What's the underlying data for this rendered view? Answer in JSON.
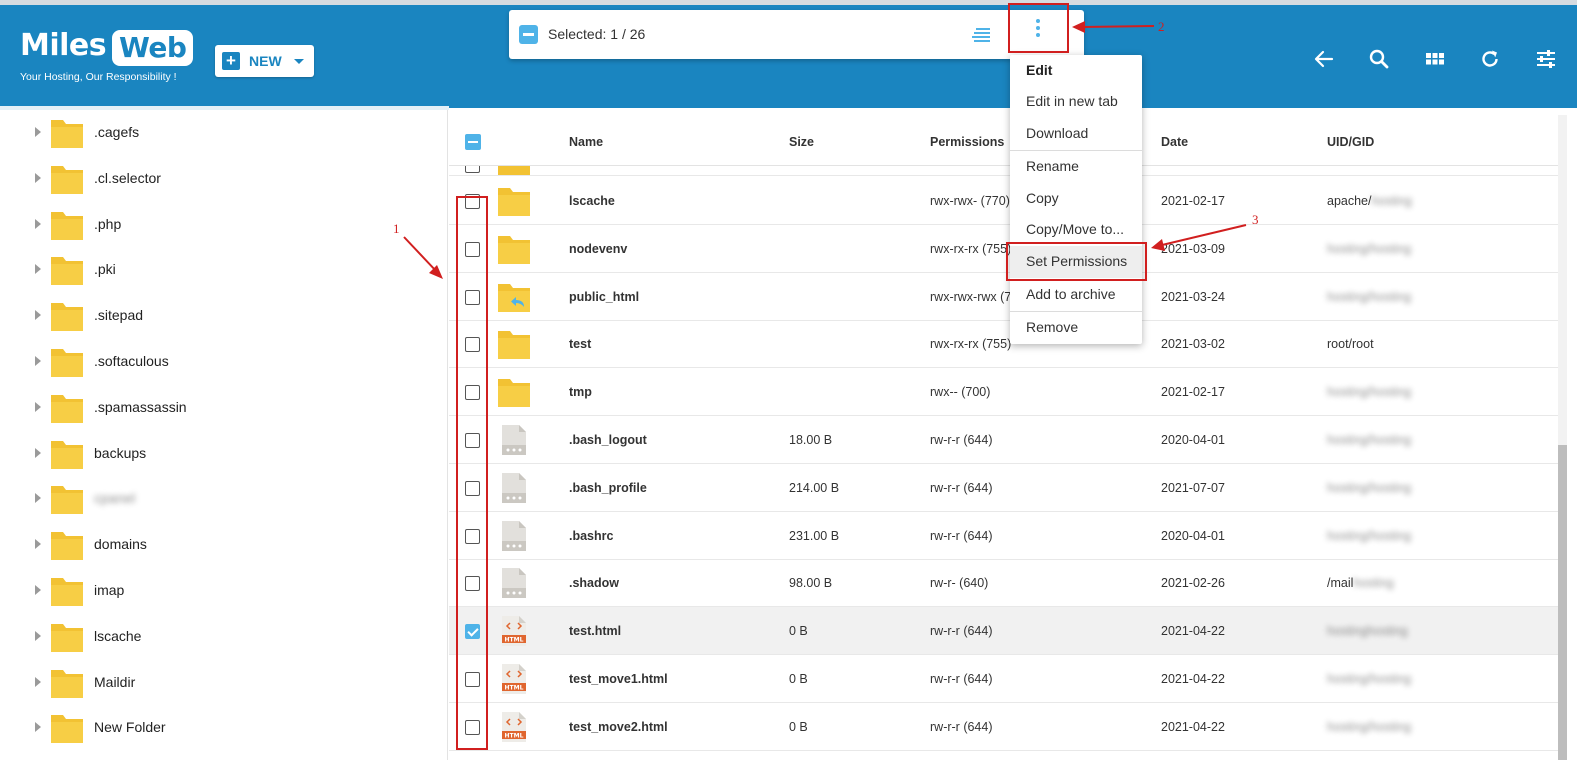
{
  "brand": {
    "logo_miles": "Miles",
    "logo_web": "Web",
    "tagline": "Your Hosting, Our Responsibility !"
  },
  "colors": {
    "header_bg": "#1a85c0",
    "accent": "#4fb3e8",
    "annotation": "#d11f1f",
    "folder": "#f2c233"
  },
  "toolbar": {
    "new_label": "NEW",
    "selection_text": "Selected: 1 / 26",
    "icons": [
      "back-arrow-icon",
      "search-icon",
      "grid-view-icon",
      "refresh-icon",
      "settings-sliders-icon"
    ]
  },
  "sidebar": {
    "items": [
      {
        "label": ".cagefs"
      },
      {
        "label": ".cl.selector"
      },
      {
        "label": ".php"
      },
      {
        "label": ".pki"
      },
      {
        "label": ".sitepad"
      },
      {
        "label": ".softaculous"
      },
      {
        "label": ".spamassassin"
      },
      {
        "label": "backups"
      },
      {
        "label": "cpanel"
      },
      {
        "label": "domains"
      },
      {
        "label": "imap"
      },
      {
        "label": "lscache"
      },
      {
        "label": "Maildir"
      },
      {
        "label": "New Folder"
      }
    ]
  },
  "list": {
    "headers": {
      "name": "Name",
      "size": "Size",
      "permissions": "Permissions",
      "date": "Date",
      "uid": "UID/GID"
    },
    "rows": [
      {
        "name": "lscache",
        "size": "",
        "permissions": "rwx-rwx- (770)",
        "date": "2021-02-17",
        "uid": "apache/",
        "uid_hidden": "hosting",
        "type": "folder"
      },
      {
        "name": "nodevenv",
        "size": "",
        "permissions": "rwx-rx-rx (755)",
        "date": "2021-03-09",
        "uid": "",
        "uid_hidden": "hosting/hosting",
        "type": "folder"
      },
      {
        "name": "public_html",
        "size": "",
        "permissions": "rwx-rwx-rwx (777)",
        "date": "2021-03-24",
        "uid": "",
        "uid_hidden": "hosting/hosting",
        "type": "folder-link"
      },
      {
        "name": "test",
        "size": "",
        "permissions": "rwx-rx-rx (755)",
        "date": "2021-03-02",
        "uid": "root/root",
        "uid_hidden": "",
        "type": "folder"
      },
      {
        "name": "tmp",
        "size": "",
        "permissions": "rwx-- (700)",
        "date": "2021-02-17",
        "uid": "",
        "uid_hidden": "hosting/hosting",
        "type": "folder"
      },
      {
        "name": ".bash_logout",
        "size": "18.00 B",
        "permissions": "rw-r-r (644)",
        "date": "2020-04-01",
        "uid": "",
        "uid_hidden": "hosting/hosting",
        "type": "file"
      },
      {
        "name": ".bash_profile",
        "size": "214.00 B",
        "permissions": "rw-r-r (644)",
        "date": "2021-07-07",
        "uid": "",
        "uid_hidden": "hosting/hosting",
        "type": "file"
      },
      {
        "name": ".bashrc",
        "size": "231.00 B",
        "permissions": "rw-r-r (644)",
        "date": "2020-04-01",
        "uid": "",
        "uid_hidden": "hosting/hosting",
        "type": "file"
      },
      {
        "name": ".shadow",
        "size": "98.00 B",
        "permissions": "rw-r- (640)",
        "date": "2021-02-26",
        "uid": "/mail",
        "uid_hidden": "hosting",
        "type": "file"
      },
      {
        "name": "test.html",
        "size": "0 B",
        "permissions": "rw-r-r (644)",
        "date": "2021-04-22",
        "uid": "",
        "uid_hidden": "hostinghosting",
        "type": "html",
        "selected": true
      },
      {
        "name": "test_move1.html",
        "size": "0 B",
        "permissions": "rw-r-r (644)",
        "date": "2021-04-22",
        "uid": "",
        "uid_hidden": "hosting/hosting",
        "type": "html"
      },
      {
        "name": "test_move2.html",
        "size": "0 B",
        "permissions": "rw-r-r (644)",
        "date": "2021-04-22",
        "uid": "",
        "uid_hidden": "hosting/hosting",
        "type": "html"
      }
    ]
  },
  "menu": {
    "items": [
      {
        "label": "Edit"
      },
      {
        "label": "Edit in new tab"
      },
      {
        "label": "Download"
      },
      {
        "label": "Rename"
      },
      {
        "label": "Copy"
      },
      {
        "label": "Copy/Move to..."
      },
      {
        "label": "Set Permissions"
      },
      {
        "label": "Add to archive"
      },
      {
        "label": "Remove"
      }
    ]
  },
  "annotations": {
    "one": "1",
    "two": "2",
    "three": "3"
  }
}
